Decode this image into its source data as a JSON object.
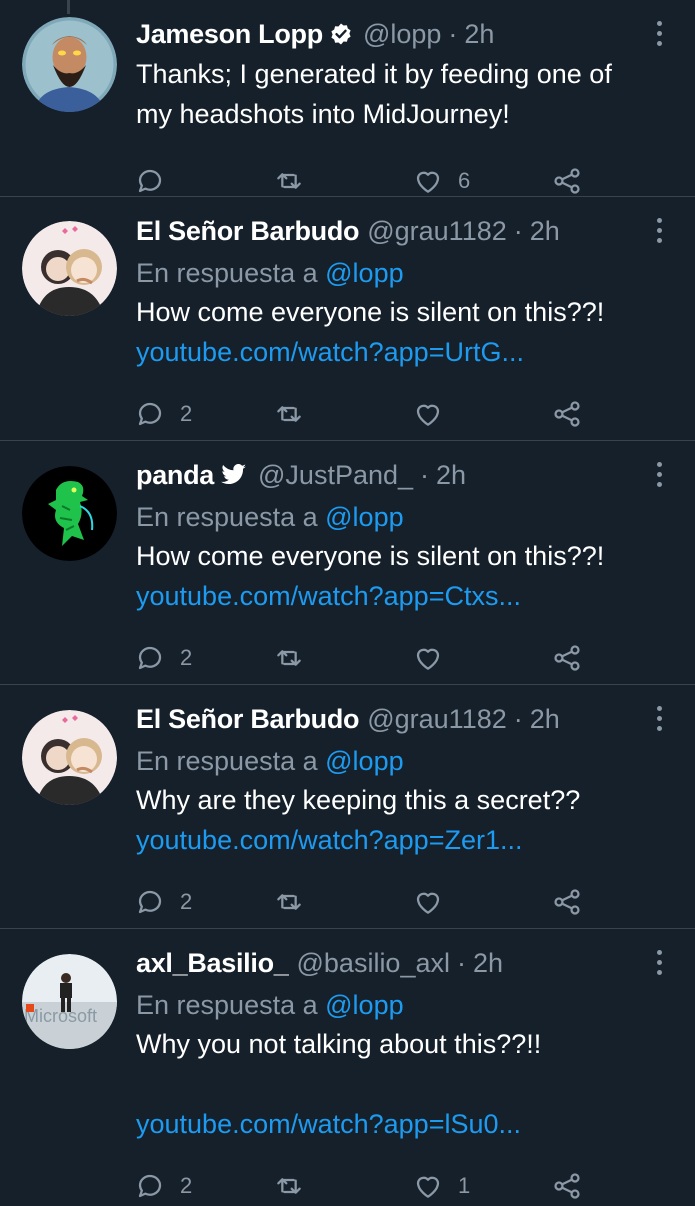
{
  "tweets": [
    {
      "name": "Jameson Lopp",
      "verified": "verified-badge",
      "handle": "@lopp",
      "dot": "·",
      "time": "2h",
      "text": "Thanks; I generated it by feeding one of my headshots into MidJourney!",
      "actions": {
        "replies": "",
        "retweets": "",
        "likes": "6"
      }
    },
    {
      "name": "El Señor Barbudo",
      "handle": "@grau1182",
      "dot": "·",
      "time": "2h",
      "reply_prefix": "En respuesta a",
      "reply_mention": "@lopp",
      "text": "How come everyone is silent on this??!",
      "link": "youtube.com/watch?app=UrtG...",
      "actions": {
        "replies": "2",
        "retweets": "",
        "likes": ""
      }
    },
    {
      "name": "panda",
      "badge": "twitter-bird-icon",
      "handle": "@JustPand_",
      "dot": "·",
      "time": "2h",
      "reply_prefix": "En respuesta a",
      "reply_mention": "@lopp",
      "text": "How come everyone is silent on this??!",
      "link": "youtube.com/watch?app=Ctxs...",
      "actions": {
        "replies": "2",
        "retweets": "",
        "likes": ""
      }
    },
    {
      "name": "El Señor Barbudo",
      "handle": "@grau1182",
      "dot": "·",
      "time": "2h",
      "reply_prefix": "En respuesta a",
      "reply_mention": "@lopp",
      "text": "Why are they keeping this a secret??",
      "link": "youtube.com/watch?app=Zer1...",
      "actions": {
        "replies": "2",
        "retweets": "",
        "likes": ""
      }
    },
    {
      "name": "axl_Basilio_",
      "handle": "@basilio_axl",
      "dot": "·",
      "time": "2h",
      "reply_prefix": "En respuesta a",
      "reply_mention": "@lopp",
      "text": "Why you not talking about this??!!",
      "link": "youtube.com/watch?app=lSu0...",
      "avatar_sign_text": "Microsoft",
      "actions": {
        "replies": "2",
        "retweets": "",
        "likes": "1"
      }
    }
  ],
  "colors": {
    "background": "#15202b",
    "primary_text": "#ffffff",
    "secondary_text": "#8b98a5",
    "link": "#1d9bf0",
    "divider": "#38444d"
  },
  "icons": [
    "more-icon",
    "reply-icon",
    "retweet-icon",
    "like-icon",
    "share-icon"
  ]
}
